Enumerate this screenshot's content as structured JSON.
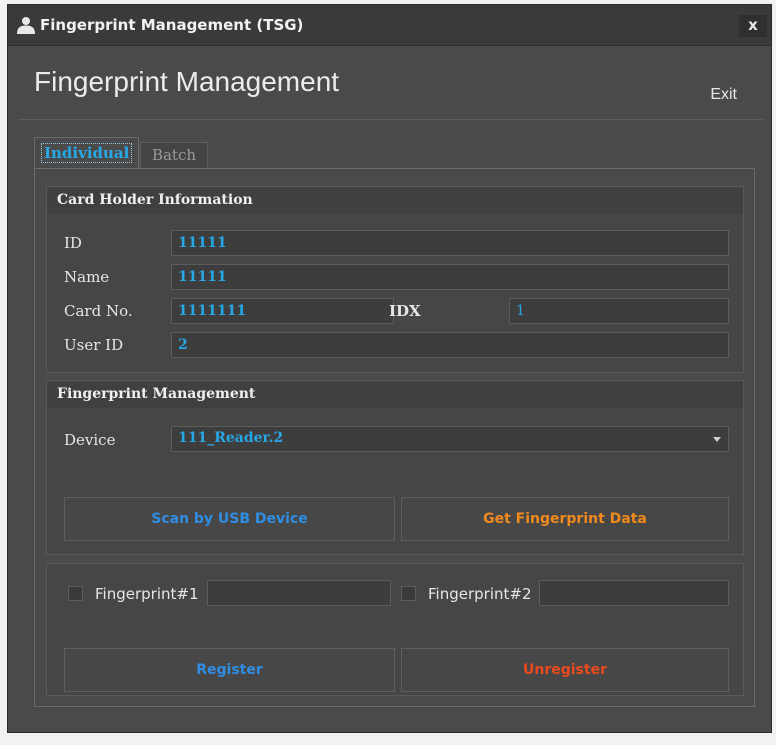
{
  "window": {
    "title": "Fingerprint Management (TSG)",
    "close_label": "x"
  },
  "header": {
    "title": "Fingerprint Management",
    "exit_label": "Exit"
  },
  "tabs": [
    {
      "label": "Individual",
      "active": true
    },
    {
      "label": "Batch",
      "active": false
    }
  ],
  "card_holder": {
    "section_title": "Card Holder Information",
    "id_label": "ID",
    "id_value": "11111",
    "name_label": "Name",
    "name_value": "11111",
    "card_no_label": "Card No.",
    "card_no_value": "1111111",
    "idx_label": "IDX",
    "idx_value": "1",
    "user_id_label": "User ID",
    "user_id_value": "2"
  },
  "fingerprint": {
    "section_title": "Fingerprint Management",
    "device_label": "Device",
    "device_value": "111_Reader.2",
    "scan_button": "Scan by USB Device",
    "get_data_button": "Get Fingerprint Data"
  },
  "registration": {
    "fp1_label": "Fingerprint#1",
    "fp1_value": "",
    "fp2_label": "Fingerprint#2",
    "fp2_value": "",
    "register_button": "Register",
    "unregister_button": "Unregister"
  },
  "colors": {
    "accent_blue": "#27a8e6",
    "scan_blue": "#2f8de4",
    "orange": "#f08a1c",
    "red": "#ea4a1e"
  },
  "icons": {
    "title_icon": "user-icon"
  }
}
